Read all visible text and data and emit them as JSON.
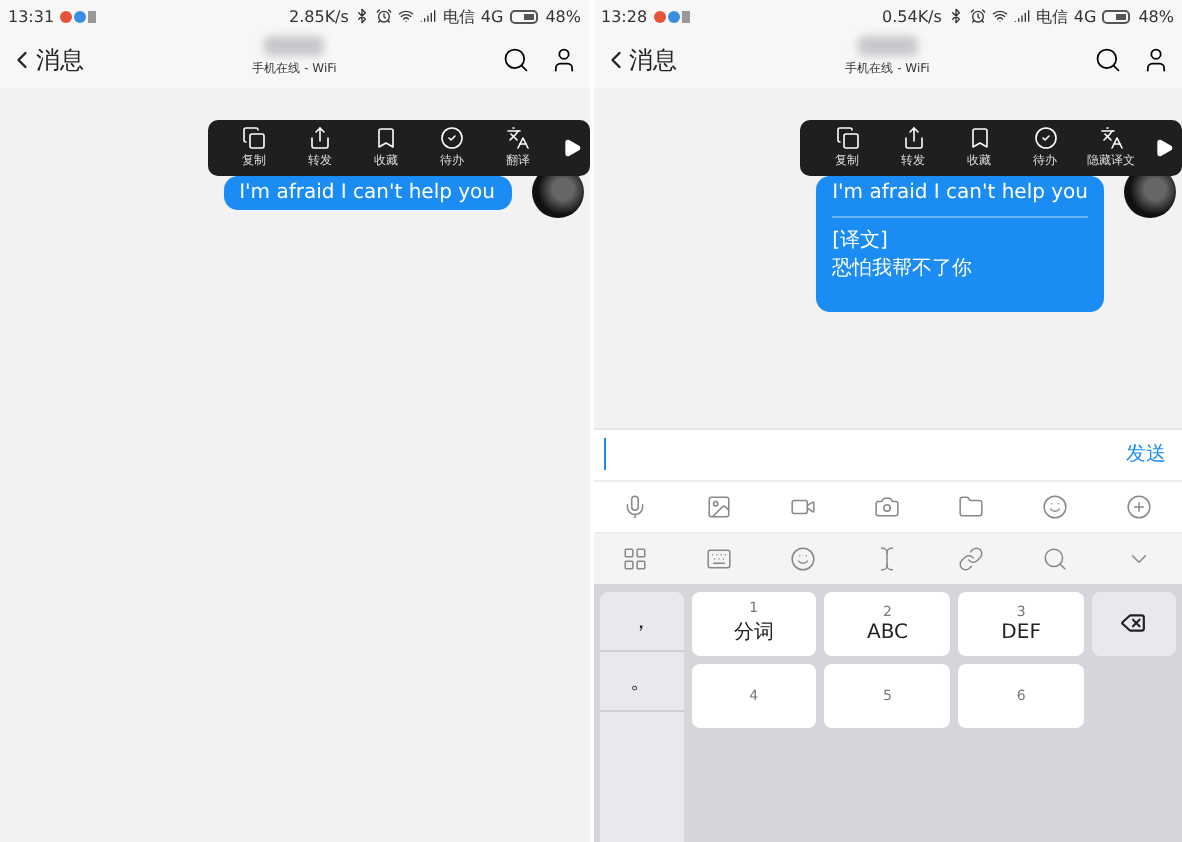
{
  "panels": [
    {
      "status_bar": {
        "time": "13:31",
        "speed": "2.85K/s",
        "carrier": "电信",
        "network": "4G",
        "battery": "48%"
      },
      "header": {
        "back_label": "消息",
        "subtitle": "手机在线 - WiFi"
      },
      "popup_menu": [
        {
          "kind": "copy",
          "label": "复制"
        },
        {
          "kind": "forward",
          "label": "转发"
        },
        {
          "kind": "favorite",
          "label": "收藏"
        },
        {
          "kind": "todo",
          "label": "待办"
        },
        {
          "kind": "translate",
          "label": "翻译"
        },
        {
          "kind": "more"
        }
      ],
      "message": {
        "text": "I'm afraid I can't help you"
      }
    },
    {
      "status_bar": {
        "time": "13:28",
        "speed": "0.54K/s",
        "carrier": "电信",
        "network": "4G",
        "battery": "48%"
      },
      "header": {
        "back_label": "消息",
        "subtitle": "手机在线 - WiFi"
      },
      "popup_menu": [
        {
          "kind": "copy",
          "label": "复制"
        },
        {
          "kind": "forward",
          "label": "转发"
        },
        {
          "kind": "favorite",
          "label": "收藏"
        },
        {
          "kind": "todo",
          "label": "待办"
        },
        {
          "kind": "translate",
          "label": "隐藏译文"
        },
        {
          "kind": "more"
        }
      ],
      "message": {
        "text": "I'm afraid I can't help you",
        "translation_label": "[译文]",
        "translation": "恐怕我帮不了你"
      },
      "composer": {
        "send_label": "发送",
        "attach_icons": [
          {
            "kind": "mic"
          },
          {
            "kind": "image"
          },
          {
            "kind": "video"
          },
          {
            "kind": "camera"
          },
          {
            "kind": "folder"
          },
          {
            "kind": "emoji"
          },
          {
            "kind": "plus"
          }
        ],
        "keyboard_toolbar": [
          {
            "kind": "grid"
          },
          {
            "kind": "keyboard"
          },
          {
            "kind": "emoji"
          },
          {
            "kind": "cursor"
          },
          {
            "kind": "link"
          },
          {
            "kind": "search"
          },
          {
            "kind": "collapse"
          }
        ],
        "punctuation_keys": [
          "，",
          "。"
        ],
        "key_rows": [
          [
            {
              "number": "1",
              "letters": "分词"
            },
            {
              "number": "2",
              "letters": "ABC"
            },
            {
              "number": "3",
              "letters": "DEF"
            }
          ],
          [
            {
              "number": "4"
            },
            {
              "number": "5"
            },
            {
              "number": "6"
            }
          ]
        ]
      }
    }
  ]
}
